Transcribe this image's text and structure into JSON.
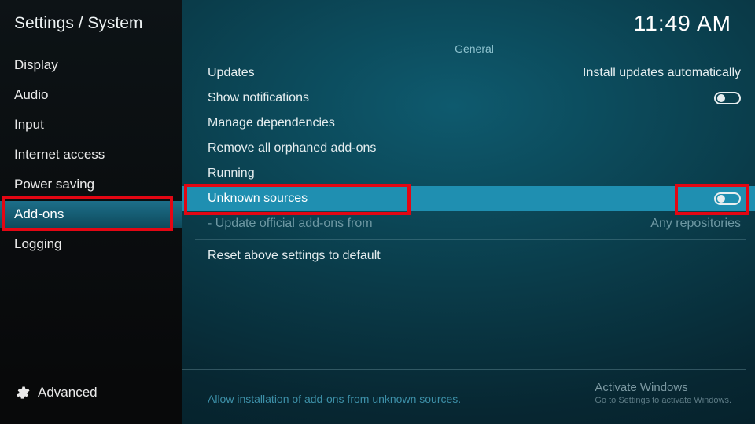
{
  "header": {
    "breadcrumb": "Settings / System",
    "clock": "11:49 AM"
  },
  "sidebar": {
    "items": [
      {
        "label": "Display"
      },
      {
        "label": "Audio"
      },
      {
        "label": "Input"
      },
      {
        "label": "Internet access"
      },
      {
        "label": "Power saving"
      },
      {
        "label": "Add-ons"
      },
      {
        "label": "Logging"
      }
    ],
    "active_index": 5,
    "footer_label": "Advanced",
    "footer_icon": "gear-icon"
  },
  "section": {
    "title": "General"
  },
  "settings": [
    {
      "label": "Updates",
      "value": "Install updates automatically",
      "type": "value"
    },
    {
      "label": "Show notifications",
      "type": "toggle",
      "state": "off"
    },
    {
      "label": "Manage dependencies",
      "type": "action"
    },
    {
      "label": "Remove all orphaned add-ons",
      "type": "action"
    },
    {
      "label": "Running",
      "type": "action"
    },
    {
      "label": "Unknown sources",
      "type": "toggle",
      "state": "off",
      "highlight": true
    },
    {
      "label": "Update official add-ons from",
      "value": "Any repositories",
      "type": "value",
      "disabled": true
    },
    {
      "label": "Reset above settings to default",
      "type": "action"
    }
  ],
  "footer": {
    "hint": "Allow installation of add-ons from unknown sources.",
    "watermark_title": "Activate Windows",
    "watermark_sub": "Go to Settings to activate Windows."
  },
  "colors": {
    "accent": "#1f8fb1",
    "highlight_border": "#e30613"
  }
}
